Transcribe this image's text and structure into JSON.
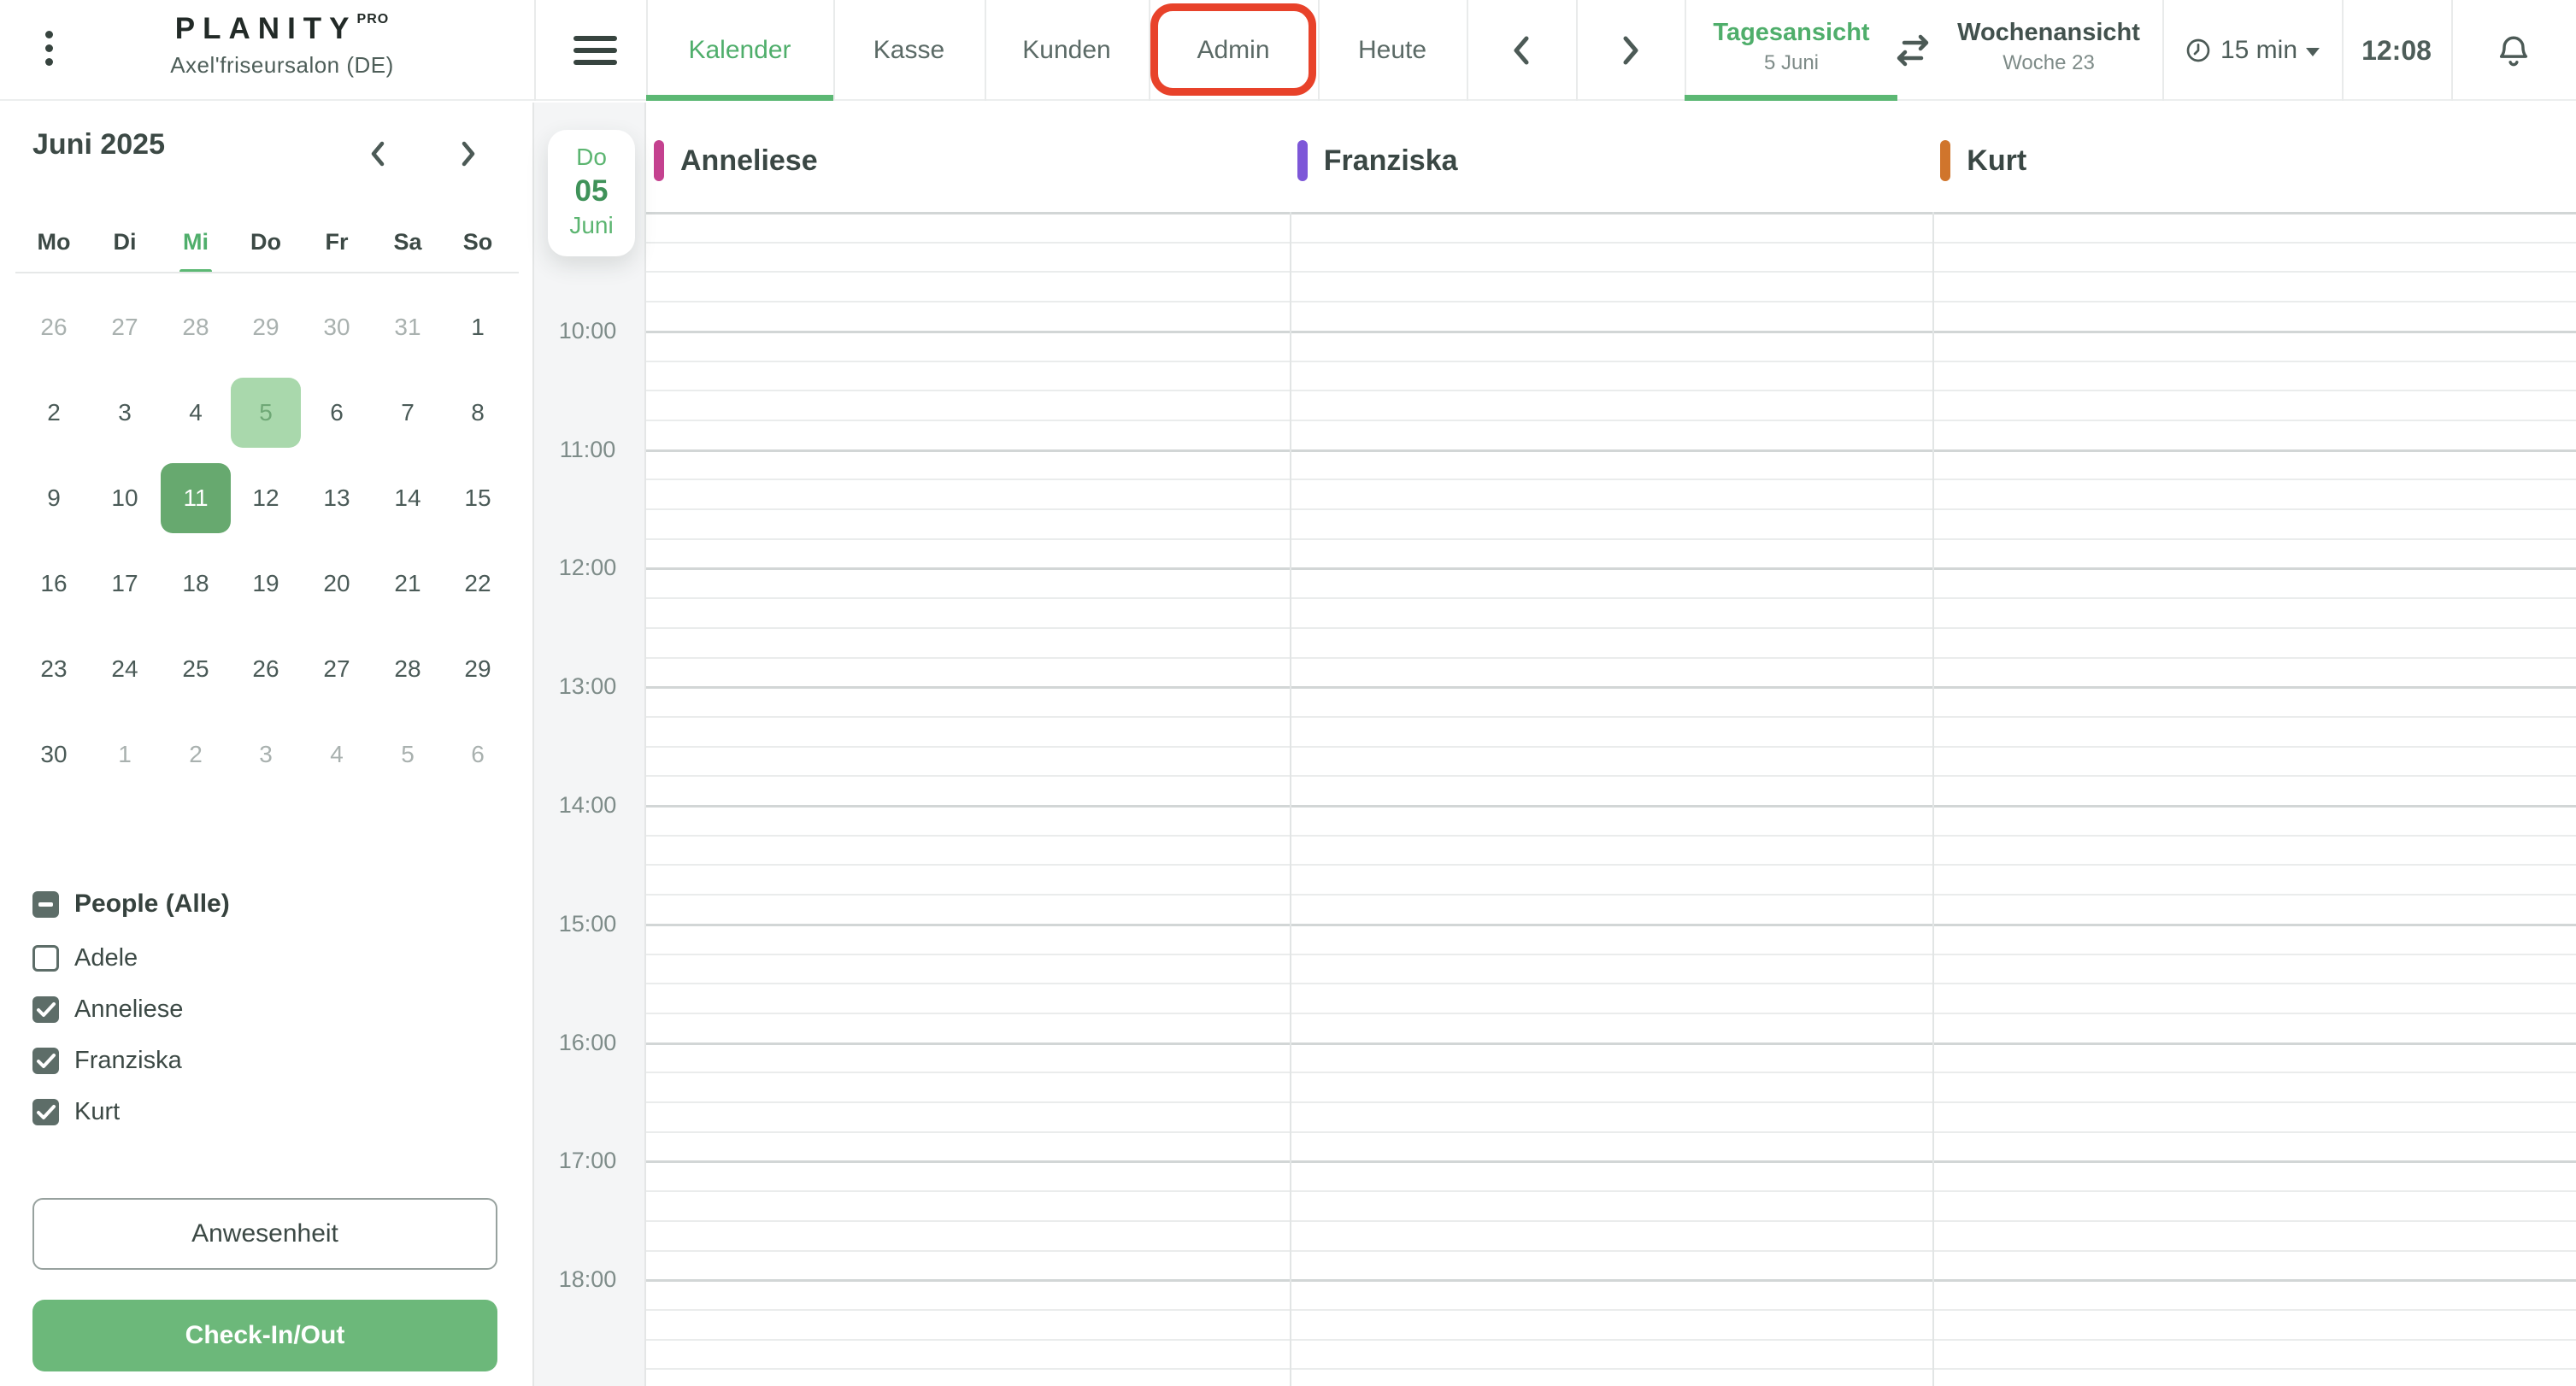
{
  "header": {
    "logo": "PLANITY",
    "logo_badge": "PRO",
    "salon_name": "Axel'friseursalon (DE)",
    "tabs": [
      {
        "label": "Kalender",
        "active": true,
        "annotated": false
      },
      {
        "label": "Kasse",
        "active": false,
        "annotated": false
      },
      {
        "label": "Kunden",
        "active": false,
        "annotated": false
      },
      {
        "label": "Admin",
        "active": false,
        "annotated": true
      },
      {
        "label": "Heute",
        "active": false,
        "annotated": false
      }
    ],
    "views": {
      "day": {
        "label": "Tagesansicht",
        "sublabel": "5 Juni",
        "active": true
      },
      "week": {
        "label": "Wochenansicht",
        "sublabel": "Woche 23",
        "active": false
      }
    },
    "interval_label": "15 min",
    "clock": "12:08"
  },
  "sidebar": {
    "mini_calendar": {
      "title": "Juni 2025",
      "weekdays": [
        {
          "label": "Mo",
          "today": false
        },
        {
          "label": "Di",
          "today": false
        },
        {
          "label": "Mi",
          "today": true
        },
        {
          "label": "Do",
          "today": false
        },
        {
          "label": "Fr",
          "today": false
        },
        {
          "label": "Sa",
          "today": false
        },
        {
          "label": "So",
          "today": false
        }
      ],
      "weeks": [
        [
          {
            "d": "26",
            "muted": true
          },
          {
            "d": "27",
            "muted": true
          },
          {
            "d": "28",
            "muted": true
          },
          {
            "d": "29",
            "muted": true
          },
          {
            "d": "30",
            "muted": true
          },
          {
            "d": "31",
            "muted": true
          },
          {
            "d": "1"
          }
        ],
        [
          {
            "d": "2"
          },
          {
            "d": "3"
          },
          {
            "d": "4"
          },
          {
            "d": "5",
            "sel": "light"
          },
          {
            "d": "6"
          },
          {
            "d": "7"
          },
          {
            "d": "8"
          }
        ],
        [
          {
            "d": "9"
          },
          {
            "d": "10"
          },
          {
            "d": "11",
            "sel": "dark"
          },
          {
            "d": "12"
          },
          {
            "d": "13"
          },
          {
            "d": "14"
          },
          {
            "d": "15"
          }
        ],
        [
          {
            "d": "16"
          },
          {
            "d": "17"
          },
          {
            "d": "18"
          },
          {
            "d": "19"
          },
          {
            "d": "20"
          },
          {
            "d": "21"
          },
          {
            "d": "22"
          }
        ],
        [
          {
            "d": "23"
          },
          {
            "d": "24"
          },
          {
            "d": "25"
          },
          {
            "d": "26"
          },
          {
            "d": "27"
          },
          {
            "d": "28"
          },
          {
            "d": "29"
          }
        ],
        [
          {
            "d": "30"
          },
          {
            "d": "1",
            "muted": true
          },
          {
            "d": "2",
            "muted": true
          },
          {
            "d": "3",
            "muted": true
          },
          {
            "d": "4",
            "muted": true
          },
          {
            "d": "5",
            "muted": true
          },
          {
            "d": "6",
            "muted": true
          }
        ]
      ]
    },
    "people": {
      "title": "People (Alle)",
      "state": "indeterminate",
      "members": [
        {
          "name": "Adele",
          "checked": false
        },
        {
          "name": "Anneliese",
          "checked": true
        },
        {
          "name": "Franziska",
          "checked": true
        },
        {
          "name": "Kurt",
          "checked": true
        }
      ]
    },
    "buttons": {
      "attendance": "Anwesenheit",
      "check_in_out": "Check-In/Out"
    }
  },
  "calendar": {
    "day_badge": {
      "weekday": "Do",
      "day": "05",
      "month": "Juni"
    },
    "staff_columns": [
      {
        "name": "Anneliese",
        "color": "#c4418f"
      },
      {
        "name": "Franziska",
        "color": "#7d57d8"
      },
      {
        "name": "Kurt",
        "color": "#d0752c"
      }
    ],
    "time_labels": [
      "10:00",
      "11:00",
      "12:00",
      "13:00",
      "14:00",
      "15:00",
      "16:00",
      "17:00",
      "18:00"
    ]
  },
  "annotation": {
    "target": "Admin tab",
    "shape": "rounded-rect"
  },
  "colors": {
    "accent_green": "#4fae6b",
    "underline_green": "#5cb874",
    "button_green": "#6cb87a",
    "day_selected_bg": "#a9d8ac",
    "day_selected_text": "#6fa876",
    "day_today_bg": "#67a96f",
    "annotation_red": "#e8422a"
  }
}
